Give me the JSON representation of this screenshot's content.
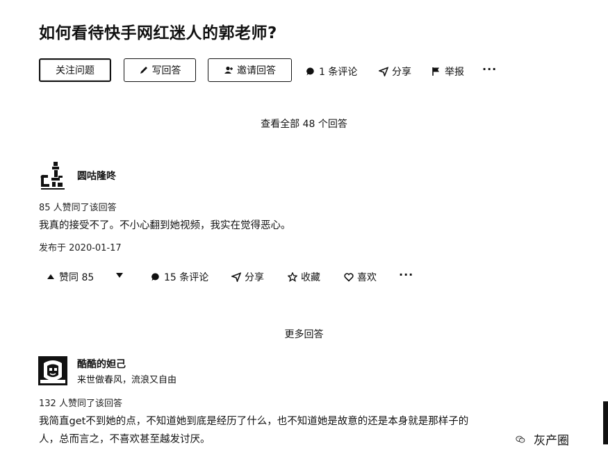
{
  "question": {
    "title": "如何看待快手网红迷人的郭老师?",
    "follow_label": "关注问题",
    "write_label": "写回答",
    "invite_label": "邀请回答",
    "comments_label": "1 条评论",
    "share_label": "分享",
    "report_label": "举报",
    "more_label": "···",
    "view_all_label": "查看全部 48 个回答"
  },
  "answer1": {
    "author": "圆咕隆咚",
    "likes_line": "85 人赞同了该回答",
    "content": "我真的接受不了。不小心翻到她视频，我实在觉得恶心。",
    "date": "发布于 2020-01-17",
    "actions": {
      "upvote": "赞同 85",
      "comments": "15 条评论",
      "share": "分享",
      "collect": "收藏",
      "like": "喜欢",
      "more": "···"
    }
  },
  "more_answers_label": "更多回答",
  "answer2": {
    "author": "酷酷的妲己",
    "bio": "来世做春风，流浪又自由",
    "likes_line": "132 人赞同了该回答",
    "content_line1": "我简直get不到她的点，不知道她到底是经历了什么，也不知道她是故意的还是本身就是那样子的",
    "content_line2": "人，总而言之，不喜欢甚至越发讨厌。"
  },
  "watermark": "灰产圈"
}
